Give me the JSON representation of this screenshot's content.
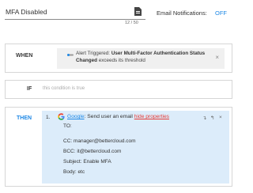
{
  "header": {
    "title_value": "MFA Disabled",
    "char_count": "12 / 50",
    "notifications_label": "Email Notifications:",
    "notifications_state": "OFF"
  },
  "when": {
    "label": "WHEN",
    "trigger_prefix": "Alert Triggered:",
    "trigger_name": "User Multi-Factor Authentication Status Changed",
    "trigger_suffix": "exceeds its threshold",
    "close": "×"
  },
  "if": {
    "label": "IF",
    "placeholder": "this condition is true"
  },
  "then": {
    "label": "THEN",
    "step": "1.",
    "provider": "Google",
    "action": "Send user an email",
    "hide_link": "hide properties",
    "controls": [
      "↴",
      "↰",
      "×"
    ],
    "fields": [
      {
        "key": "TO:",
        "value": ""
      },
      {
        "key": "CC:",
        "value": "manager@bettercloud.com"
      },
      {
        "key": "BCC:",
        "value": "it@bettercloud.com"
      },
      {
        "key": "Subject:",
        "value": "Enable MFA"
      },
      {
        "key": "Body:",
        "value": "etc"
      }
    ]
  },
  "colors": {
    "accent": "#1e88e5",
    "link_red": "#e53935",
    "then_bg": "#dcecfa"
  }
}
